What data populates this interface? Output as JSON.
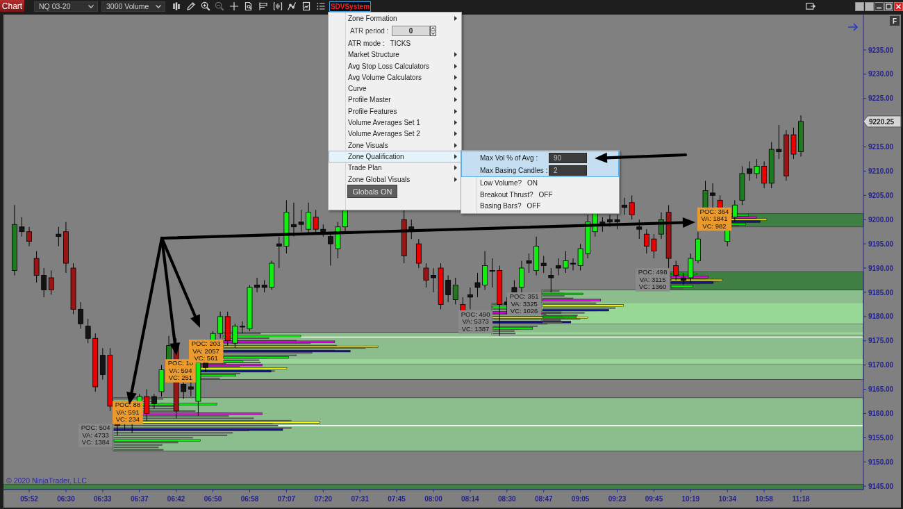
{
  "toolbar": {
    "chart_button": "Chart",
    "instrument": "NQ 03-20",
    "interval": "3000 Volume",
    "tools": [
      {
        "disabled": false
      },
      {
        "disabled": false
      },
      {
        "disabled": false
      },
      {
        "disabled": true
      },
      {
        "disabled": false
      },
      {
        "disabled": false
      },
      {
        "disabled": false
      },
      {
        "disabled": false
      },
      {
        "disabled": false
      },
      {
        "disabled": false
      },
      {
        "disabled": false
      }
    ],
    "indicator": {
      "label": "SDVSystem",
      "expanded": true
    }
  },
  "chart": {
    "corner_button": "F",
    "stats_labels": [
      {
        "color": "#8a8a8a",
        "lines": [
          "POC: 504",
          "VA: 4733",
          "VC: 1384"
        ]
      },
      {
        "color": "#eb9a2e",
        "lines": [
          "POC: 88",
          "VA: 591",
          "VC: 234"
        ]
      },
      {
        "color": "#eb9a2e",
        "lines": [
          "POC: 10",
          "VA: 594",
          "VC: 251"
        ]
      },
      {
        "color": "#eb9a2e",
        "lines": [
          "POC: 203",
          "VA: 2057",
          "VC: 561"
        ]
      },
      {
        "color": "#8a8a8a",
        "lines": [
          "POC: 490",
          "VA: 5373",
          "VC: 1387"
        ]
      },
      {
        "color": "#8a8a8a",
        "lines": [
          "POC: 351",
          "VA: 3325",
          "VC: 1026"
        ]
      },
      {
        "color": "#8a8a8a",
        "lines": [
          "POC: 498",
          "VA: 3115",
          "VC: 1360"
        ]
      },
      {
        "color": "#eb9a2e",
        "lines": [
          "POC: 364",
          "VA: 1841",
          "VC: 982"
        ]
      }
    ],
    "price_labels": [
      "9235.00",
      "9230.00",
      "9225.00",
      "9215.00",
      "9210.00",
      "9205.00",
      "9200.00",
      "9195.00",
      "9190.00",
      "9185.00",
      "9180.00",
      "9175.00",
      "9170.00",
      "9165.00",
      "9160.00",
      "9155.00",
      "9150.00",
      "9145.00"
    ],
    "last_price": "9220.25",
    "copyright": "© 2020 NinjaTrader, LLC",
    "time_labels": [
      "05:52",
      "06:30",
      "06:33",
      "06:37",
      "06:42",
      "06:50",
      "06:58",
      "07:07",
      "07:20",
      "07:31",
      "07:45",
      "08:00",
      "08:14",
      "08:30",
      "08:47",
      "09:05",
      "09:23",
      "09:45",
      "10:19",
      "10:34",
      "10:58",
      "11:18"
    ]
  },
  "menu": {
    "items": [
      {
        "kind": "submenu",
        "label": "Zone Formation",
        "selected": false
      },
      {
        "kind": "spinner",
        "label": "ATR period :",
        "value": "0",
        "selected": false
      },
      {
        "kind": "setting",
        "label": "ATR mode :",
        "value": "TICKS",
        "selected": false
      },
      {
        "kind": "submenu",
        "label": "Market Structure",
        "selected": false
      },
      {
        "kind": "submenu",
        "label": "Avg Stop Loss Calculators",
        "selected": false
      },
      {
        "kind": "submenu",
        "label": "Avg Volume Calculators",
        "selected": false
      },
      {
        "kind": "submenu",
        "label": "Curve",
        "selected": false
      },
      {
        "kind": "submenu",
        "label": "Profile Master",
        "selected": false
      },
      {
        "kind": "submenu",
        "label": "Profile Features",
        "selected": false
      },
      {
        "kind": "submenu",
        "label": "Volume Averages Set 1",
        "selected": false
      },
      {
        "kind": "submenu",
        "label": "Volume Averages Set 2",
        "selected": false
      },
      {
        "kind": "submenu",
        "label": "Zone Visuals",
        "selected": false
      },
      {
        "kind": "submenu",
        "label": "Zone Qualification",
        "selected": true,
        "submenu": {
          "items": [
            {
              "kind": "input",
              "label": "Max Vol % of Avg :",
              "value": "90",
              "selected": true
            },
            {
              "kind": "input",
              "label": "Max Basing Candles :",
              "value": "2",
              "selected": true
            },
            {
              "kind": "setting",
              "label": "Low Volume?",
              "value": "ON",
              "selected": false
            },
            {
              "kind": "setting",
              "label": "Breakout Thrust?",
              "value": "OFF",
              "selected": false
            },
            {
              "kind": "setting",
              "label": "Basing Bars?",
              "value": "OFF",
              "selected": false
            }
          ]
        }
      },
      {
        "kind": "submenu",
        "label": "Trade Plan",
        "selected": false
      },
      {
        "kind": "submenu",
        "label": "Zone Global Visuals",
        "selected": false
      },
      {
        "kind": "button",
        "label": "Globals ON",
        "selected": false
      }
    ]
  }
}
